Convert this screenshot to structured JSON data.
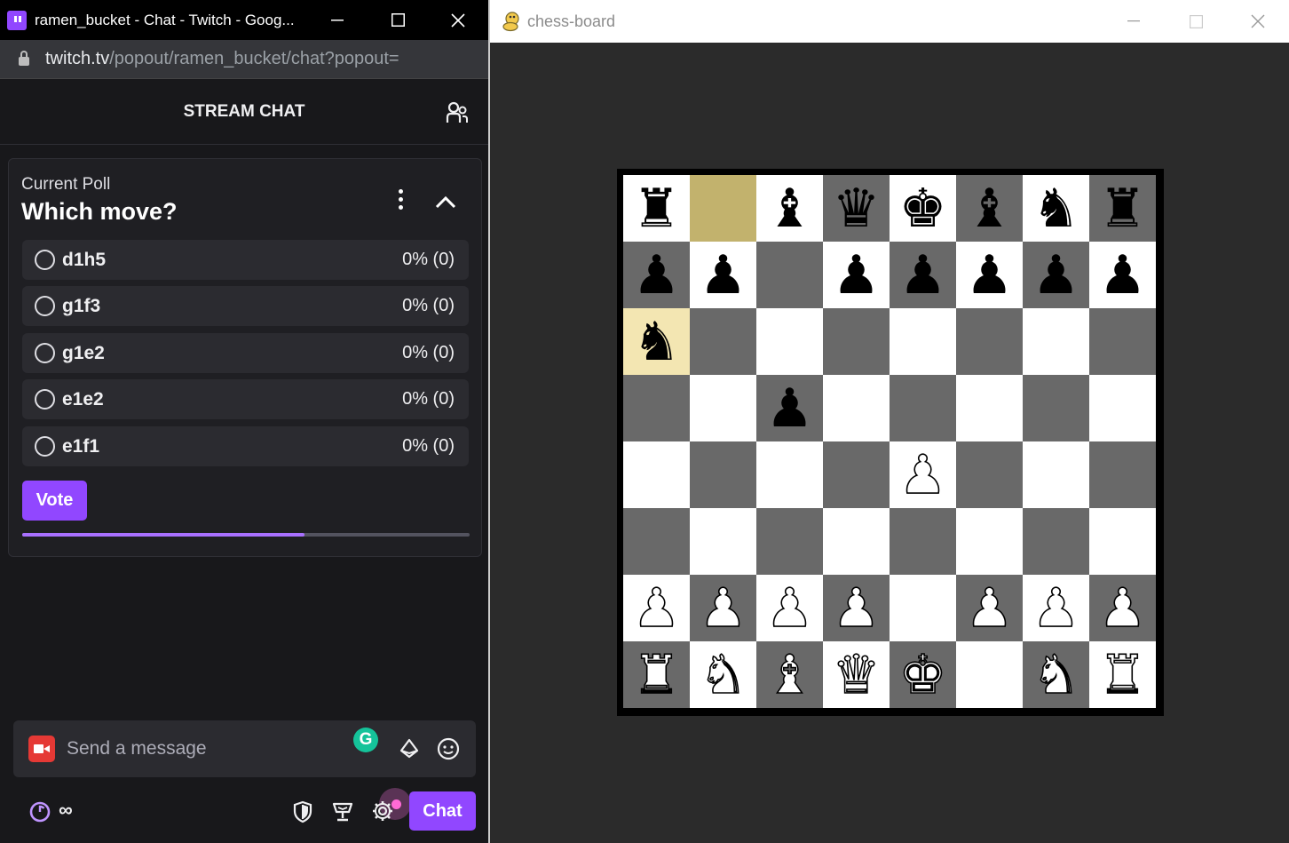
{
  "chat_window": {
    "title": "ramen_bucket - Chat - Twitch - Goog...",
    "url_host": "twitch.tv",
    "url_path": "/popout/ramen_bucket/chat?popout=",
    "header": "STREAM CHAT",
    "poll": {
      "label": "Current Poll",
      "question": "Which move?",
      "options": [
        {
          "label": "d1h5",
          "result": "0% (0)"
        },
        {
          "label": "g1f3",
          "result": "0% (0)"
        },
        {
          "label": "g1e2",
          "result": "0% (0)"
        },
        {
          "label": "e1e2",
          "result": "0% (0)"
        },
        {
          "label": "e1f1",
          "result": "0% (0)"
        }
      ],
      "vote_label": "Vote",
      "time_remaining_fraction": 0.63
    },
    "message_placeholder": "Send a message",
    "grammarly_letter": "G",
    "channel_points": "∞",
    "chat_button_label": "Chat",
    "colors": {
      "accent": "#9147ff",
      "background": "#18181b"
    }
  },
  "chess_window": {
    "title": "chess-board",
    "board_ranks": [
      [
        "br",
        "",
        "bb",
        "bq",
        "bk",
        "bb",
        "bn",
        "br"
      ],
      [
        "bp",
        "bp",
        "",
        "bp",
        "bp",
        "bp",
        "bp",
        "bp"
      ],
      [
        "bn",
        "",
        "",
        "",
        "",
        "",
        "",
        ""
      ],
      [
        "",
        "",
        "bp",
        "",
        "",
        "",
        "",
        ""
      ],
      [
        "",
        "",
        "",
        "",
        "wp",
        "",
        "",
        ""
      ],
      [
        "",
        "",
        "",
        "",
        "",
        "",
        "",
        ""
      ],
      [
        "wp",
        "wp",
        "wp",
        "wp",
        "",
        "wp",
        "wp",
        "wp"
      ],
      [
        "wr",
        "wn",
        "wb",
        "wq",
        "wk",
        "",
        "wn",
        "wr"
      ]
    ],
    "highlighted_squares": [
      "b8",
      "a6"
    ],
    "colors": {
      "light": "#ffffff",
      "dark": "#696969",
      "highlight": "#c2b26d"
    }
  }
}
